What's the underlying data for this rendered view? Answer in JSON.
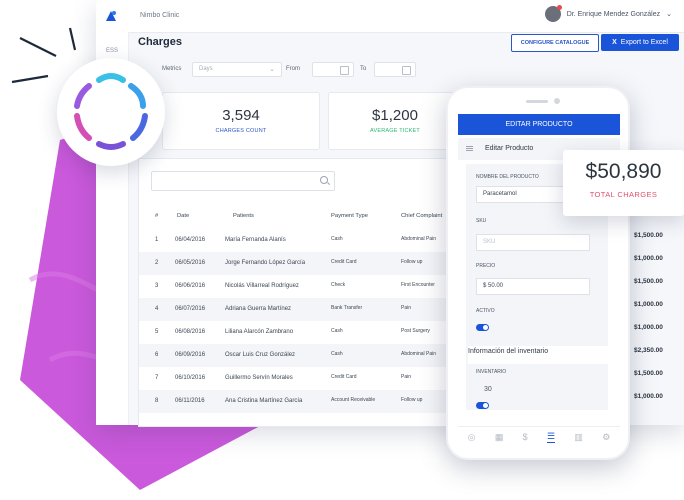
{
  "header": {
    "clinic": "Nimbo Clinic",
    "user_name": "Dr. Enrique Mendez González"
  },
  "sidebar": {
    "icon_label": "ESS"
  },
  "page": {
    "title": "Charges",
    "configure_label": "CONFIGURE CATALOGUE",
    "export_label": "Export to Excel",
    "export_icon": "X"
  },
  "filters": {
    "metrics_label": "Metrics",
    "metrics_value": "Days",
    "from_label": "From",
    "to_label": "To"
  },
  "stats": [
    {
      "value": "3,594",
      "label": "CHARGES COUNT",
      "color": "#2a56c6"
    },
    {
      "value": "$1,200",
      "label": "AVERAGE TICKET",
      "color": "#2bb673"
    }
  ],
  "table": {
    "columns": [
      "#",
      "Date",
      "Patients",
      "Payment Type",
      "Chief Complaint"
    ],
    "rows": [
      {
        "n": "1",
        "date": "06/04/2016",
        "patient": "María Fernanda Alanís",
        "payment": "Cash",
        "complaint": "Abdominal Pain",
        "amount": "$1,500.00"
      },
      {
        "n": "2",
        "date": "06/05/2016",
        "patient": "Jorge Fernando López García",
        "payment": "Credit Card",
        "complaint": "Follow up",
        "amount": "$1,000.00"
      },
      {
        "n": "3",
        "date": "06/06/2016",
        "patient": "Nicolás Villarreal Rodríguez",
        "payment": "Check",
        "complaint": "First Encounter",
        "amount": "$1,500.00"
      },
      {
        "n": "4",
        "date": "06/07/2016",
        "patient": "Adriana Guerra Martínez",
        "payment": "Bank Transfer",
        "complaint": "Pain",
        "amount": "$1,000.00"
      },
      {
        "n": "5",
        "date": "06/08/2016",
        "patient": "Liliana Alarcón Zambrano",
        "payment": "Cash",
        "complaint": "Post Surgery",
        "amount": "$1,000.00"
      },
      {
        "n": "6",
        "date": "06/09/2016",
        "patient": "Oscar Luis Cruz González",
        "payment": "Cash",
        "complaint": "Abdominal Pain",
        "amount": "$2,350.00"
      },
      {
        "n": "7",
        "date": "06/10/2016",
        "patient": "Guillermo Servín Morales",
        "payment": "Credit Card",
        "complaint": "Pain",
        "amount": "$1,500.00"
      },
      {
        "n": "8",
        "date": "06/11/2016",
        "patient": "Ana Cristina Martínez García",
        "payment": "Account Receivable",
        "complaint": "Follow up",
        "amount": "$1,000.00"
      }
    ]
  },
  "phone": {
    "header": "EDITAR PRODUCTO",
    "subheader": "Editar Producto",
    "name_label": "NOMBRE DEL PRODUCTO",
    "name_value": "Paracetamol",
    "sku_label": "SKU",
    "sku_placeholder": "SKU",
    "price_label": "PRECIO",
    "price_value": "$ 50.00",
    "active_label": "ACTIVO",
    "inventory_title": "Información del inventario",
    "inventory_label": "INVENTARIO",
    "inventory_value": "30"
  },
  "total": {
    "value": "$50,890",
    "label": "TOTAL CHARGES"
  },
  "colors": {
    "primary": "#1a55d9",
    "magenta": "#c64bd8",
    "accent_pink": "#e0506d"
  }
}
